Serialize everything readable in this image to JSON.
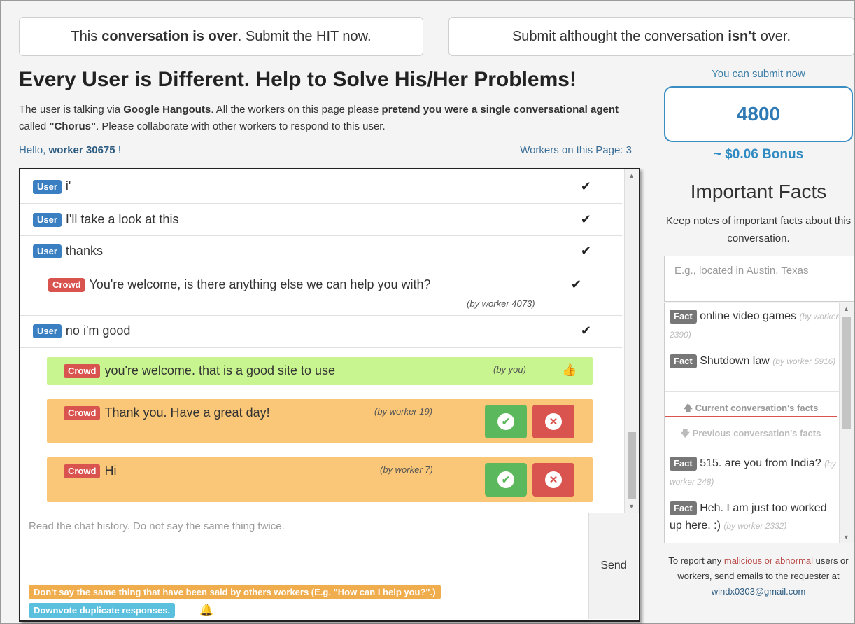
{
  "top_buttons": {
    "over": {
      "pre": "This",
      "bold": "conversation is over",
      "post": ". Submit the HIT now."
    },
    "not_over": {
      "pre": "Submit althought the conversation",
      "bold": "isn't",
      "post": "over."
    }
  },
  "page_title": "Every User is Different. Help to Solve His/Her Problems!",
  "description": {
    "p1": "The user is talking via ",
    "b1": "Google Hangouts",
    "p2": ". All the workers on this page please ",
    "b2": "pretend you were a single conversational agent",
    "p3": " called ",
    "b3": "\"Chorus\"",
    "p4": ". Please collaborate with other workers to respond to this user."
  },
  "hello": {
    "prefix": "Hello, ",
    "worker": "worker 30675",
    "suffix": " !"
  },
  "workers_on_page": "Workers on this Page: 3",
  "chat": {
    "messages": [
      {
        "label": "User",
        "text": "i'"
      },
      {
        "label": "User",
        "text": "I'll take a look at this"
      },
      {
        "label": "User",
        "text": "thanks"
      },
      {
        "label": "Crowd",
        "text": "You're welcome, is there anything else we can help you with?",
        "by": "(by worker 4073)"
      },
      {
        "label": "User",
        "text": "no i'm good"
      }
    ],
    "proposals": [
      {
        "label": "Crowd",
        "text": "you're welcome. that is a good site to use",
        "by": "(by you)"
      },
      {
        "label": "Crowd",
        "text": "Thank you. Have a great day!",
        "by": "(by worker 19)"
      },
      {
        "label": "Crowd",
        "text": "Hi",
        "by": "(by worker 7)"
      }
    ],
    "input_placeholder": "Read the chat history. Do not say the same thing twice.",
    "send_label": "Send",
    "tip_duplicate": "Don't say the same thing that have been said by others workers (E.g. \"How can I help you?\".)",
    "tip_downvote": "Downvote duplicate responses."
  },
  "sidebar": {
    "submit_now": "You can submit now",
    "points": "4800",
    "bonus": "~ $0.06 Bonus",
    "facts_title": "Important Facts",
    "facts_desc": "Keep notes of important facts about this conversation.",
    "fact_placeholder": "E.g., located in Austin, Texas",
    "fact_label": "Fact",
    "current_facts": [
      {
        "text": "online video games",
        "by": "(by worker 2390)"
      },
      {
        "text": "Shutdown law",
        "by": "(by worker 5916)"
      }
    ],
    "current_header": "Current conversation's facts",
    "previous_header": "Previous conversation's facts",
    "previous_facts": [
      {
        "text": "515. are you from India?",
        "by": "(by worker 248)"
      },
      {
        "text": "Heh. I am just too worked up here. :)",
        "by": "(by worker 2332)"
      }
    ],
    "report": {
      "p1": "To report any ",
      "red": "malicious or abnormal",
      "p2": " users or workers, send emails to the requester at ",
      "email": "windx0303@gmail.com"
    }
  },
  "colors": {
    "user_label": "#3a7fc1",
    "crowd_label": "#d9534f",
    "accepted": "#c8f58f",
    "pending": "#fac778",
    "accept": "#5cb85c",
    "reject": "#d9534f"
  },
  "icons": [
    "check-icon",
    "thumbs-up-icon",
    "accept-check-icon",
    "reject-x-icon",
    "bell-icon",
    "arrow-up-icon",
    "arrow-down-icon"
  ]
}
